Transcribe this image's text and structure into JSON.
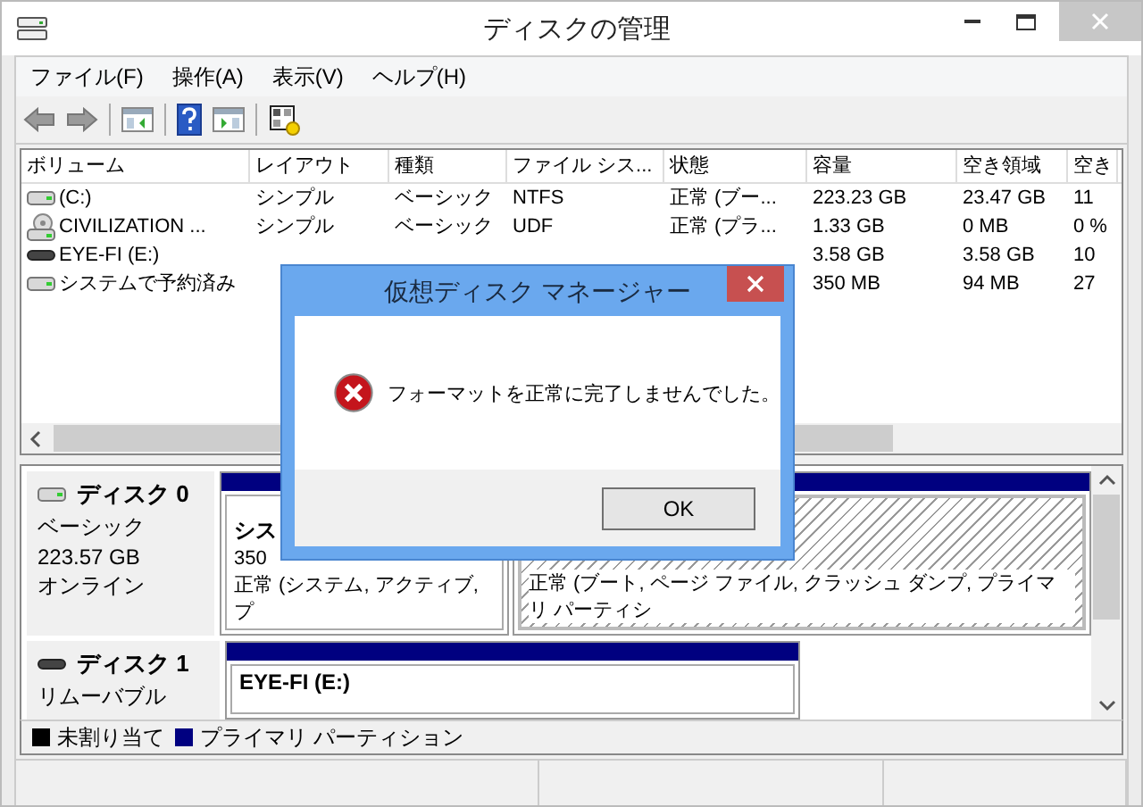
{
  "window": {
    "title": "ディスクの管理"
  },
  "menu": [
    "ファイル(F)",
    "操作(A)",
    "表示(V)",
    "ヘルプ(H)"
  ],
  "volume_table": {
    "columns": [
      "ボリューム",
      "レイアウト",
      "種類",
      "ファイル シス...",
      "状態",
      "容量",
      "空き領域",
      "空き"
    ],
    "rows": [
      {
        "kind": "drive",
        "cells": [
          "(C:)",
          "シンプル",
          "ベーシック",
          "NTFS",
          "正常 (ブー...",
          "223.23 GB",
          "23.47 GB",
          "11"
        ]
      },
      {
        "kind": "disc",
        "cells": [
          "CIVILIZATION ...",
          "シンプル",
          "ベーシック",
          "UDF",
          "正常 (プラ...",
          "1.33 GB",
          "0 MB",
          "0 %"
        ]
      },
      {
        "kind": "removable",
        "cells": [
          "EYE-FI (E:)",
          null,
          null,
          null,
          null,
          "3.58 GB",
          "3.58 GB",
          "10"
        ]
      },
      {
        "kind": "drive",
        "cells": [
          "システムで予約済み",
          null,
          null,
          null,
          null,
          "350 MB",
          "94 MB",
          "27"
        ]
      }
    ]
  },
  "disks": [
    {
      "kind": "fixed",
      "name": "ディスク 0",
      "info": [
        "ベーシック",
        "223.57 GB",
        "オンライン"
      ],
      "partitions": [
        {
          "selected": false,
          "name": "シス",
          "details": [
            "350",
            "正常 (システム, アクティブ, プ"
          ]
        },
        {
          "selected": true,
          "details": [
            "正常 (ブート, ページ ファイル, クラッシュ ダンプ, プライマリ パーティシ"
          ]
        }
      ]
    },
    {
      "kind": "removable",
      "name": "ディスク 1",
      "info": [
        "リムーバブル"
      ],
      "partitions": [
        {
          "selected": false,
          "name": "EYE-FI (E:)"
        }
      ]
    }
  ],
  "legend": [
    {
      "label": "未割り当て",
      "color": "#000000"
    },
    {
      "label": "プライマリ パーティション",
      "color": "#000080"
    }
  ],
  "dialog": {
    "title": "仮想ディスク マネージャー",
    "message": "フォーマットを正常に完了しませんでした。",
    "buttons": [
      "OK"
    ]
  }
}
